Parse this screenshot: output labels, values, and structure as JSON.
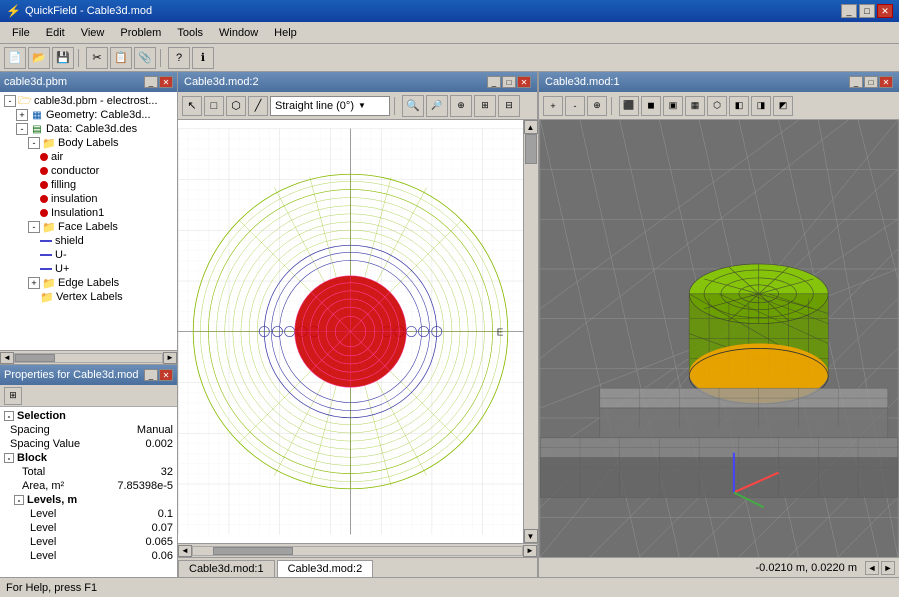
{
  "titlebar": {
    "title": "QuickField - Cable3d.mod",
    "icon": "⚡"
  },
  "menubar": {
    "items": [
      "File",
      "Edit",
      "View",
      "Problem",
      "Tools",
      "Window",
      "Help"
    ]
  },
  "left_panel": {
    "title": "cable3d.pbm",
    "tree": {
      "root": "cable3d.pbm - electrost...",
      "geometry": "Geometry: Cable3d...",
      "data": "Data: Cable3d.des",
      "body_labels": "Body Labels",
      "body_items": [
        "air",
        "conductor",
        "filling",
        "insulation",
        "Insulation1"
      ],
      "face_labels": "Face Labels",
      "face_items": [
        "shield",
        "U-",
        "U+"
      ],
      "edge_labels": "Edge Labels",
      "vertex_labels": "Vertex Labels"
    }
  },
  "properties_panel": {
    "title": "Properties for Cable3d.mod",
    "section_selection": "Selection",
    "spacing_label": "Spacing",
    "spacing_value": "Manual",
    "spacing_value_label": "Spacing Value",
    "spacing_value_num": "0.002",
    "block_label": "Block",
    "total_label": "Total",
    "total_value": "32",
    "area_label": "Area, m²",
    "area_value": "7.85398e-5",
    "levels_label": "Levels, m",
    "level1_label": "Level",
    "level1_value": "0.1",
    "level2_label": "Level",
    "level2_value": "0.07",
    "level3_label": "Level",
    "level3_value": "0.065",
    "level4_label": "Level",
    "level4_value": "0.06"
  },
  "mesh_window": {
    "title": "Cable3d.mod:2",
    "toolbar_dropdown": "Straight line (0°)",
    "tab1": "Cable3d.mod:1",
    "tab2": "Cable3d.mod:2"
  },
  "model_3d_window": {
    "title": "Cable3d.mod:1"
  },
  "statusbar": {
    "help_text": "For Help, press F1",
    "coords": "-0.0210 m, 0.0220 m",
    "nav_left": "◄",
    "nav_right": "►"
  }
}
